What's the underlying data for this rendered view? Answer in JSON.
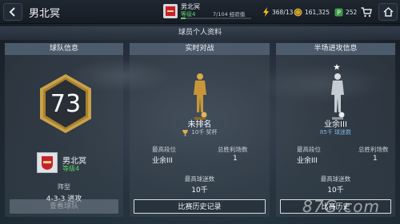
{
  "header": {
    "title": "男北冥",
    "club": {
      "name": "男北冥",
      "level": "等级4",
      "xp_text": "7/104 经验值",
      "xp_progress": 0.067
    },
    "energy": "368/13",
    "coins": "161,325",
    "points": "252"
  },
  "section_title": "球员个人资料",
  "team_panel": {
    "title": "球队信息",
    "rating": "73",
    "club_name": "男北冥",
    "club_level": "等级4",
    "formation_label": "阵型",
    "formation_value": "4-3-3 进攻",
    "button": "查看球队"
  },
  "live_panel": {
    "title": "实时对战",
    "rank": "未排名",
    "trophies": "10千 奖杯",
    "best_rank_label": "最高段位",
    "best_rank_value": "业余III",
    "total_wins_label": "总胜利场数",
    "total_wins_value": "1",
    "max_fans_label": "最高球迷数",
    "max_fans_value": "10千",
    "button": "比赛历史记录"
  },
  "half_panel": {
    "title": "半场进攻信息",
    "rank": "业余III",
    "fans": "85千 球迷数",
    "best_rank_label": "最高段位",
    "best_rank_value": "业余III",
    "total_wins_label": "总胜利场数",
    "total_wins_value": "1",
    "max_fans_label": "最高球迷数",
    "max_fans_value": "10千",
    "button": "比赛历史"
  },
  "watermark": "87G.com",
  "colors": {
    "accent_green": "#5fd06a",
    "gold": "#e0b04a",
    "panel_head": "#526272"
  }
}
